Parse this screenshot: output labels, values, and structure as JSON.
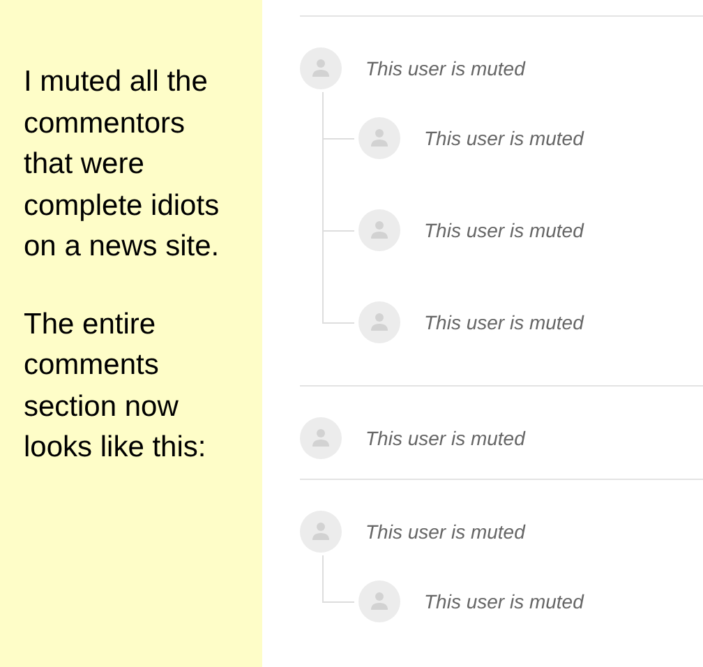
{
  "caption": {
    "paragraphs": [
      "I muted all the commentors that were complete idiots on a news site.",
      "The entire comments section now looks like this:"
    ]
  },
  "threads": [
    {
      "text": "This user is muted",
      "replies": [
        {
          "text": "This user is muted"
        },
        {
          "text": "This user is muted"
        },
        {
          "text": "This user is muted"
        }
      ]
    },
    {
      "text": "This user is muted"
    },
    {
      "text": "This user is muted",
      "replies": [
        {
          "text": "This user is muted"
        }
      ]
    }
  ]
}
